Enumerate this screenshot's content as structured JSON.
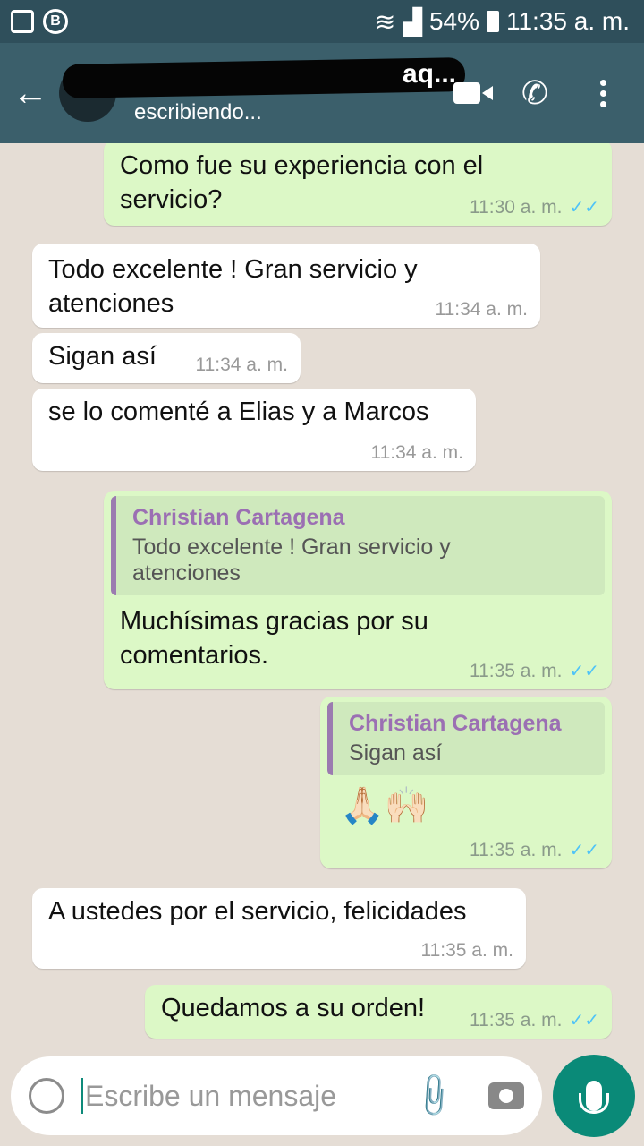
{
  "statusbar": {
    "battery": "54%",
    "time": "11:35 a. m.",
    "b_label": "B"
  },
  "header": {
    "contact_name": "aq...",
    "status": "escribiendo..."
  },
  "messages": [
    {
      "id": "m1",
      "text": "Como fue su experiencia con el servicio?",
      "time": "11:30 a. m.",
      "direction": "out"
    },
    {
      "id": "m2",
      "text": "Todo excelente ! Gran servicio y atenciones",
      "time": "11:34 a. m.",
      "direction": "in"
    },
    {
      "id": "m3",
      "text": "Sigan así",
      "time": "11:34 a. m.",
      "direction": "in"
    },
    {
      "id": "m4",
      "text": "se lo comenté a Elias y a Marcos",
      "time": "11:34 a. m.",
      "direction": "in"
    },
    {
      "id": "m5",
      "quote_author": "Christian Cartagena",
      "quote_text": "Todo excelente ! Gran servicio y atenciones",
      "text": "Muchísimas gracias por su comentarios.",
      "time": "11:35 a. m.",
      "direction": "out"
    },
    {
      "id": "m6",
      "quote_author": "Christian Cartagena",
      "quote_text": "Sigan así",
      "text": "🙏🏻🙌🏻",
      "time": "11:35 a. m.",
      "direction": "out"
    },
    {
      "id": "m7",
      "text": "A ustedes por el servicio, felicidades",
      "time": "11:35 a. m.",
      "direction": "in"
    },
    {
      "id": "m8",
      "text": "Quedamos a su orden!",
      "time": "11:35 a. m.",
      "direction": "out"
    }
  ],
  "input": {
    "placeholder": "Escribe un mensaje"
  },
  "colors": {
    "header": "#3b5f6b",
    "outgoing": "#dcf8c6",
    "incoming": "#ffffff",
    "accent": "#0a8a78",
    "read_ticks": "#4fc3f7"
  }
}
